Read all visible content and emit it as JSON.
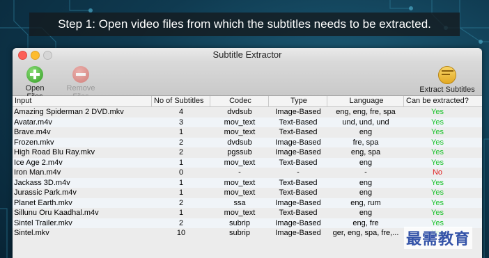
{
  "caption": "Step 1: Open video files from which the subtitles needs to be extracted.",
  "window": {
    "title": "Subtitle Extractor"
  },
  "toolbar": {
    "open_label": "Open Files",
    "remove_label": "Remove Files",
    "extract_label": "Extract Subtitles"
  },
  "table": {
    "headers": [
      "Input",
      "No of Subtitles",
      "Codec",
      "Type",
      "Language",
      "Can be extracted?"
    ],
    "rows": [
      {
        "input": "Amazing Spiderman 2 DVD.mkv",
        "count": "4",
        "codec": "dvdsub",
        "type": "Image-Based",
        "language": "eng, eng, fre, spa",
        "can": "Yes"
      },
      {
        "input": "Avatar.m4v",
        "count": "3",
        "codec": "mov_text",
        "type": "Text-Based",
        "language": "und, und, und",
        "can": "Yes"
      },
      {
        "input": "Brave.m4v",
        "count": "1",
        "codec": "mov_text",
        "type": "Text-Based",
        "language": "eng",
        "can": "Yes"
      },
      {
        "input": "Frozen.mkv",
        "count": "2",
        "codec": "dvdsub",
        "type": "Image-Based",
        "language": "fre, spa",
        "can": "Yes"
      },
      {
        "input": "High Road Blu Ray.mkv",
        "count": "2",
        "codec": "pgssub",
        "type": "Image-Based",
        "language": "eng, spa",
        "can": "Yes"
      },
      {
        "input": "Ice Age 2.m4v",
        "count": "1",
        "codec": "mov_text",
        "type": "Text-Based",
        "language": "eng",
        "can": "Yes"
      },
      {
        "input": "Iron Man.m4v",
        "count": "0",
        "codec": "-",
        "type": "-",
        "language": "-",
        "can": "No"
      },
      {
        "input": "Jackass 3D.m4v",
        "count": "1",
        "codec": "mov_text",
        "type": "Text-Based",
        "language": "eng",
        "can": "Yes"
      },
      {
        "input": "Jurassic Park.m4v",
        "count": "1",
        "codec": "mov_text",
        "type": "Text-Based",
        "language": "eng",
        "can": "Yes"
      },
      {
        "input": "Planet Earth.mkv",
        "count": "2",
        "codec": "ssa",
        "type": "Image-Based",
        "language": "eng, rum",
        "can": "Yes"
      },
      {
        "input": "Sillunu Oru Kaadhal.m4v",
        "count": "1",
        "codec": "mov_text",
        "type": "Text-Based",
        "language": "eng",
        "can": "Yes"
      },
      {
        "input": "Sintel Trailer.mkv",
        "count": "2",
        "codec": "subrip",
        "type": "Image-Based",
        "language": "eng, fre",
        "can": "Yes"
      },
      {
        "input": "Sintel.mkv",
        "count": "10",
        "codec": "subrip",
        "type": "Image-Based",
        "language": "ger, eng, spa, fre,...",
        "can": "Yes"
      }
    ]
  },
  "watermark": "最需教育",
  "colors": {
    "yes": "#1ac22a",
    "no": "#e02020"
  }
}
